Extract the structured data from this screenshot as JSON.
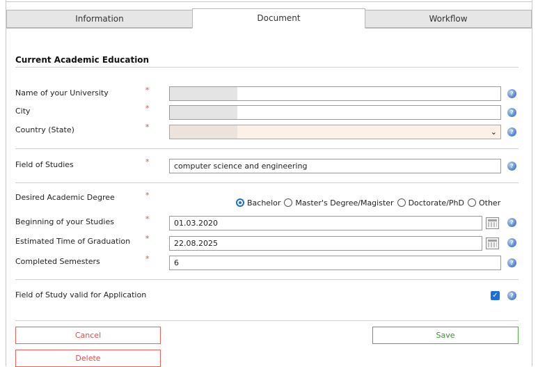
{
  "tabs": [
    {
      "label": "Information"
    },
    {
      "label": "Document"
    },
    {
      "label": "Workflow"
    }
  ],
  "section": {
    "title": "Current Academic Education"
  },
  "required_marker": "*",
  "fields": {
    "university": {
      "label": "Name of your University",
      "value": ""
    },
    "city": {
      "label": "City",
      "value": ""
    },
    "country": {
      "label": "Country (State)",
      "value": ""
    },
    "field_of_studies": {
      "label": "Field of Studies",
      "value": "computer science and engineering"
    },
    "degree": {
      "label": "Desired Academic Degree",
      "options": [
        "Bachelor",
        "Master's Degree/Magister",
        "Doctorate/PhD",
        "Other"
      ],
      "selected": "Bachelor"
    },
    "beginning": {
      "label": "Beginning of your Studies",
      "value": "01.03.2020"
    },
    "graduation": {
      "label": "Estimated Time of Graduation",
      "value": "22.08.2025"
    },
    "semesters": {
      "label": "Completed Semesters",
      "value": "6"
    },
    "valid_for_application": {
      "label": "Field of Study valid for Application",
      "checked": true
    }
  },
  "help_glyph": "?",
  "checkmark_glyph": "✓",
  "dropdown_glyph": "⌄",
  "buttons": {
    "cancel": "Cancel",
    "save": "Save",
    "delete": "Delete"
  },
  "colors": {
    "accent": "#1a6fd9",
    "danger": "#e14a4a",
    "success": "#3b8e32",
    "required": "#e0513f"
  }
}
